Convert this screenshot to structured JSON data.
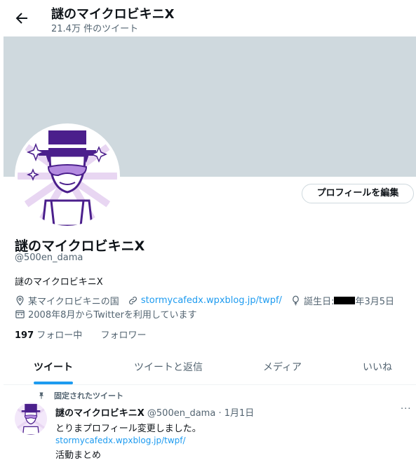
{
  "header": {
    "title": "謎のマイクロビキニX",
    "tweet_count": "21.4万 件のツイート"
  },
  "profile": {
    "name": "謎のマイクロビキニX",
    "handle": "@500en_dama",
    "bio": "謎のマイクロビキニX",
    "edit_button": "プロフィールを編集",
    "location": "某マイクロビキニの国",
    "website": "stormycafedx.wpxblog.jp/twpf/",
    "birthday_prefix": "誕生日: ",
    "birthday_suffix": "年3月5日",
    "joined": "2008年8月からTwitterを利用しています",
    "following_count": "197",
    "following_label": "フォロー中",
    "followers_label": "フォロワー"
  },
  "tabs": [
    {
      "label": "ツイート"
    },
    {
      "label": "ツイートと返信"
    },
    {
      "label": "メディア"
    },
    {
      "label": "いいね"
    }
  ],
  "tweet": {
    "pinned_label": "固定されたツイート",
    "name": "謎のマイクロビキニX",
    "handle": "@500en_dama",
    "sep": " · ",
    "date": "1月1日",
    "more": "···",
    "line1": "とりまプロフィール変更しました。",
    "link": "stormycafedx.wpxblog.jp/twpf/",
    "line3": "活動まとめ"
  },
  "colors": {
    "accent": "#1d9bf0",
    "banner": "#cfd9de",
    "avatar_purple": "#4b1f8c"
  }
}
